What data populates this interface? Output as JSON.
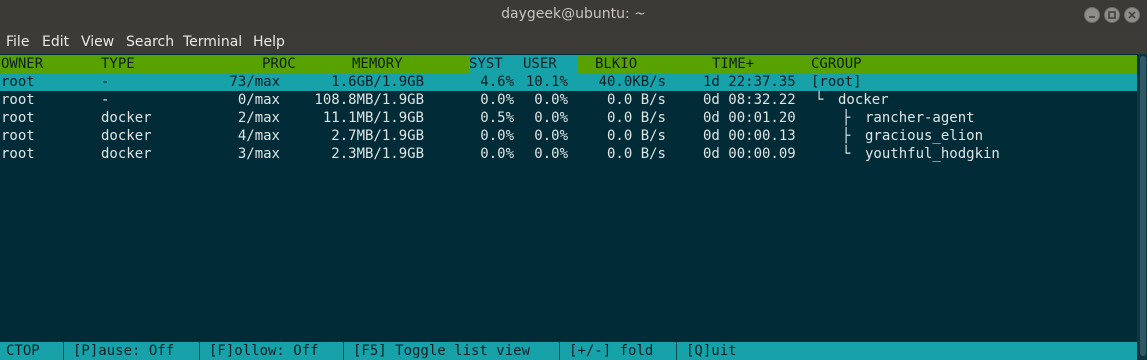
{
  "window": {
    "title": "daygeek@ubuntu: ~",
    "colors": {
      "titlebar": "#3b3a36",
      "terminal_bg": "#012b36",
      "header_bg": "#58a200",
      "highlight": "#17a2aa"
    }
  },
  "menu": [
    "File",
    "Edit",
    "View",
    "Search",
    "Terminal",
    "Help"
  ],
  "table": {
    "headers": [
      "OWNER",
      "TYPE",
      "PROC",
      "MEMORY",
      "SYST",
      "USER",
      "BLKIO",
      "TIME+",
      "CGROUP"
    ],
    "rows": [
      {
        "owner": "root",
        "type": "-",
        "proc": "73/max",
        "memory": "1.6GB/1.9GB",
        "syst": "4.6%",
        "user": "10.1%",
        "blkio": "40.0KB/s",
        "time": "1d 22:37.35",
        "cgroup": "[root]",
        "tree": ""
      },
      {
        "owner": "root",
        "type": "-",
        "proc": "0/max",
        "memory": "108.8MB/1.9GB",
        "syst": "0.0%",
        "user": "0.0%",
        "blkio": "0.0 B/s",
        "time": "0d 08:32.22",
        "cgroup": "docker",
        "tree": "└"
      },
      {
        "owner": "root",
        "type": "docker",
        "proc": "2/max",
        "memory": "11.1MB/1.9GB",
        "syst": "0.5%",
        "user": "0.0%",
        "blkio": "0.0 B/s",
        "time": "0d 00:01.20",
        "cgroup": "rancher-agent",
        "tree": "├"
      },
      {
        "owner": "root",
        "type": "docker",
        "proc": "4/max",
        "memory": "2.7MB/1.9GB",
        "syst": "0.0%",
        "user": "0.0%",
        "blkio": "0.0 B/s",
        "time": "0d 00:00.13",
        "cgroup": "gracious_elion",
        "tree": "├"
      },
      {
        "owner": "root",
        "type": "docker",
        "proc": "3/max",
        "memory": "2.3MB/1.9GB",
        "syst": "0.0%",
        "user": "0.0%",
        "blkio": "0.0 B/s",
        "time": "0d 00:00.09",
        "cgroup": "youthful_hodgkin",
        "tree": "└"
      }
    ]
  },
  "footer": [
    "CTOP",
    "[P]ause: Off",
    "[F]ollow: Off",
    "[F5] Toggle list view",
    "[+/-] fold",
    "[Q]uit"
  ]
}
